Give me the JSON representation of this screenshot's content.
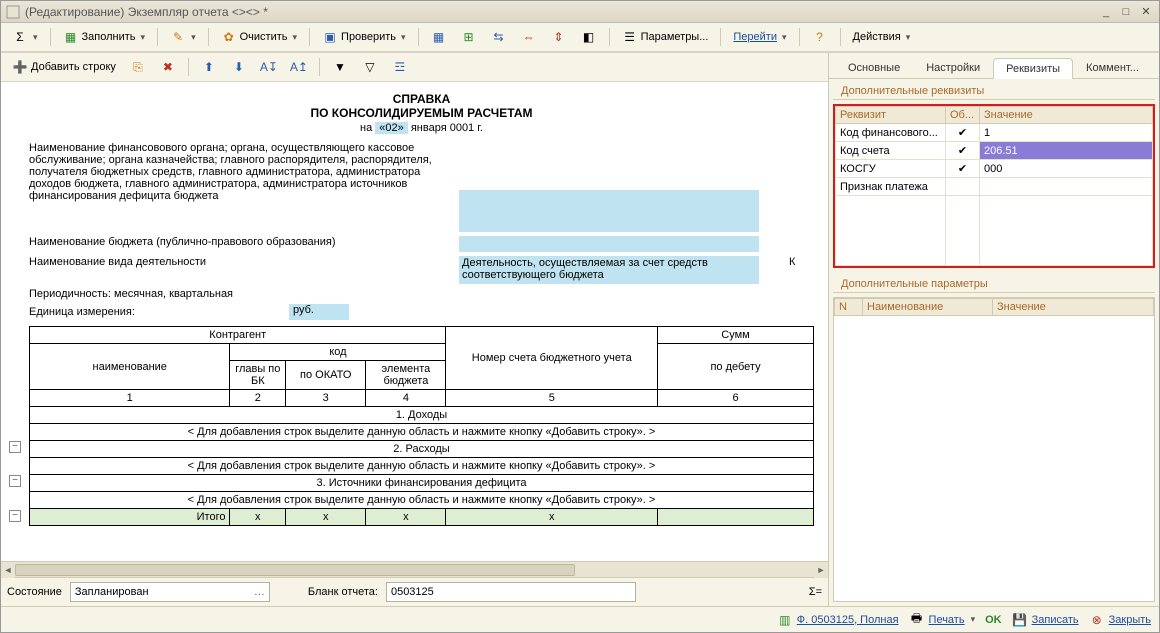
{
  "window": {
    "title": "(Редактирование) Экземпляр отчета <><> *"
  },
  "toolbar1": {
    "sigma": "Σ",
    "fill": "Заполнить",
    "clear": "Очистить",
    "check": "Проверить",
    "params": "Параметры...",
    "goto": "Перейти",
    "actions": "Действия"
  },
  "toolbar2": {
    "add_row": "Добавить строку"
  },
  "doc": {
    "title": "СПРАВКА",
    "subtitle": "ПО КОНСОЛИДИРУЕМЫМ РАСЧЕТАМ",
    "date_prefix": "на",
    "date_day": "«02»",
    "date_rest": "января 0001 г.",
    "lbl_org": "Наименование финансовового органа; органа, осуществляющего кассовое обслуживание; органа казначейства; главного распорядителя, распорядителя, получателя бюджетных средств, главного администратора, администратора доходов бюджета, главного администратора, администратора источников финансирования дефицита бюджета",
    "lbl_budget": "Наименование бюджета (публично-правового образования)",
    "lbl_activity": "Наименование вида деятельности",
    "val_activity": "Деятельность, осуществляемая за счет средств соответствующего бюджета",
    "activity_suffix": "К",
    "lbl_period": "Периодичность: месячная, квартальная",
    "lbl_unit": "Единица измерения:",
    "val_unit": "руб.",
    "cols": {
      "kontragent": "Контрагент",
      "kod": "код",
      "naimen": "наименование",
      "glavy": "главы по БК",
      "okato": "по ОКАТО",
      "elem": "элемента бюджета",
      "nomer": "Номер счета бюджетного учета",
      "summ": "Сумм",
      "debet": "по дебету",
      "c1": "1",
      "c2": "2",
      "c3": "3",
      "c4": "4",
      "c5": "5",
      "c6": "6"
    },
    "sections": {
      "s1": "1. Доходы",
      "s2": "2. Расходы",
      "s3": "3. Источники финансирования дефицита",
      "hint": "< Для добавления строк выделите данную область и нажмите кнопку «Добавить строку». >",
      "itogo": "Итого",
      "x": "x"
    }
  },
  "leftbottom": {
    "state_label": "Состояние",
    "state_value": "Запланирован",
    "blank_label": "Бланк отчета:",
    "blank_value": "0503125",
    "sigma": "Σ="
  },
  "tabs": {
    "t1": "Основные",
    "t2": "Настройки",
    "t3": "Реквизиты",
    "t4": "Коммент..."
  },
  "right": {
    "group1_title": "Дополнительные реквизиты",
    "cols": {
      "req": "Реквизит",
      "ob": "Об...",
      "val": "Значение"
    },
    "rows": [
      {
        "name": "Код финансового...",
        "chk": true,
        "val": "1"
      },
      {
        "name": "Код счета",
        "chk": true,
        "val": "206.51"
      },
      {
        "name": "КОСГУ",
        "chk": true,
        "val": "000"
      }
    ],
    "row_extra": "Признак платежа",
    "group2_title": "Дополнительные параметры",
    "pcols": {
      "n": "N",
      "name": "Наименование",
      "val": "Значение"
    }
  },
  "footer": {
    "form": "Ф. 0503125, Полная",
    "print": "Печать",
    "ok": "OK",
    "save": "Записать",
    "close": "Закрыть"
  }
}
